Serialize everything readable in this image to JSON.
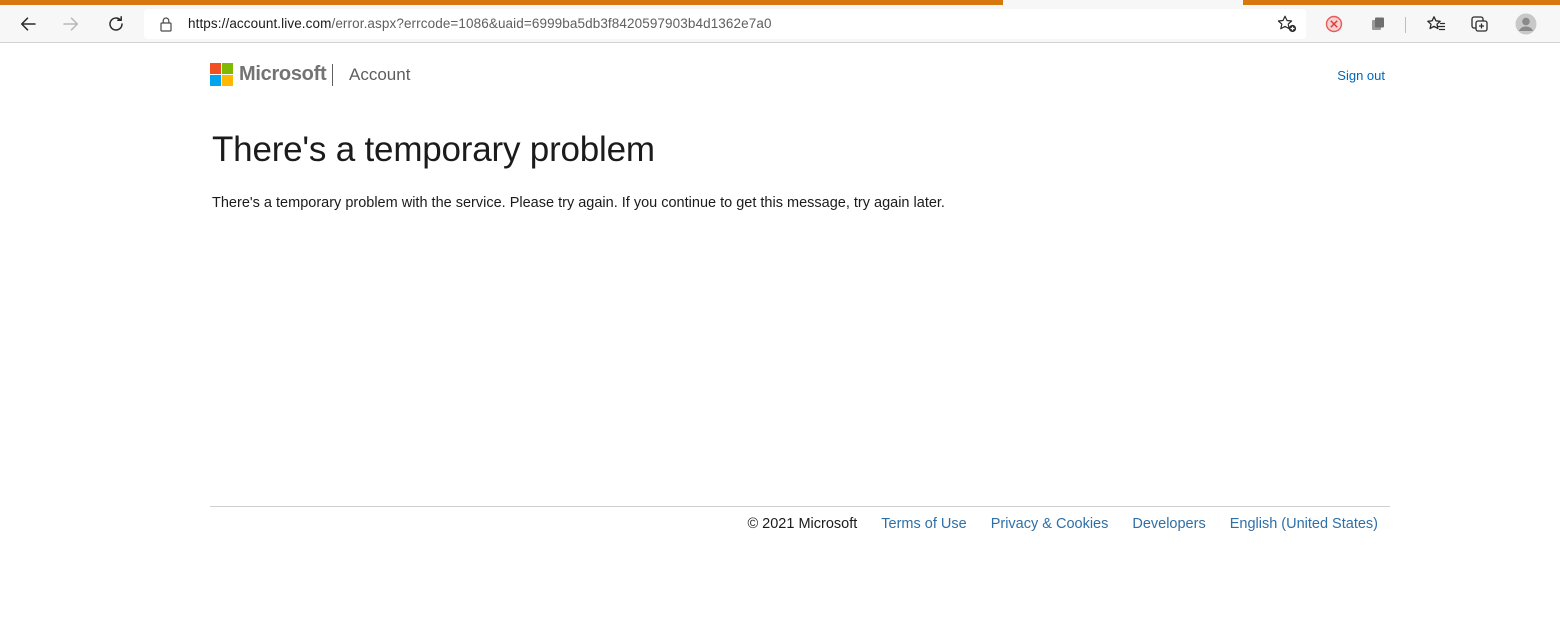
{
  "browser": {
    "url_host": "https://account.live.com",
    "url_path": "/error.aspx?errcode=1086&uaid=6999ba5db3f8420597903b4d1362e7a0",
    "accent_color": "#d7770f"
  },
  "header": {
    "brand": "Microsoft",
    "section": "Account",
    "sign_out": "Sign out",
    "logo_colors": [
      "#f25022",
      "#7fba00",
      "#00a4ef",
      "#ffb900"
    ]
  },
  "main": {
    "title": "There's a temporary problem",
    "message": "There's a temporary problem with the service. Please try again. If you continue to get this message, try again later."
  },
  "footer": {
    "copyright": "© 2021 Microsoft",
    "links": [
      "Terms of Use",
      "Privacy & Cookies",
      "Developers",
      "English (United States)"
    ]
  },
  "colors": {
    "link": "#0067b8",
    "text": "#1b1b1b"
  }
}
